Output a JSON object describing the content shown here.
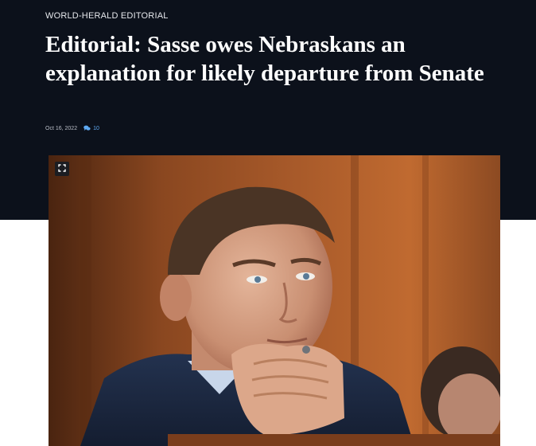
{
  "article": {
    "kicker": "WORLD-HERALD EDITORIAL",
    "headline": "Editorial: Sasse owes Nebraskans an explanation for likely departure from Senate",
    "date": "Oct 16, 2022",
    "comment_count": "10"
  },
  "media": {
    "expand_icon": "expand-icon",
    "comment_icon": "comment-bubble-icon"
  },
  "colors": {
    "header_background": "#0c111b",
    "headline_text": "#ffffff",
    "comment_accent": "#5ea9f2"
  }
}
